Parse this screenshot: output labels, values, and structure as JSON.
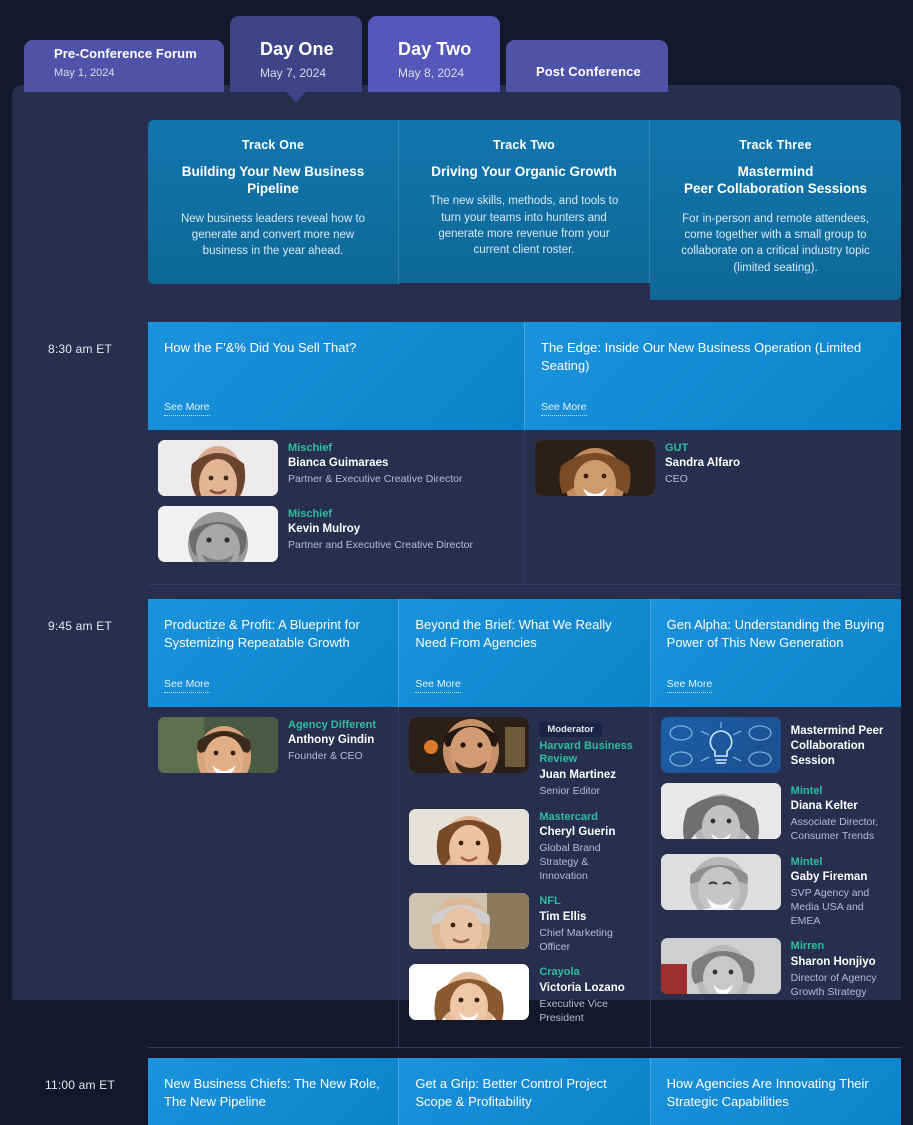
{
  "tabs": [
    {
      "name": "Pre-Conference Forum",
      "label": "Pre-Conference Forum",
      "date": "May 1, 2024",
      "active": false
    },
    {
      "name": "Day One",
      "label": "Day One",
      "date": "May 7, 2024",
      "active": true
    },
    {
      "name": "Day Two",
      "label": "Day Two",
      "date": "May 8, 2024",
      "active": false
    },
    {
      "name": "Post Conference",
      "label": "Post Conference",
      "date": "",
      "active": false
    }
  ],
  "tracks": [
    {
      "num": "Track One",
      "title": "Building Your New Business Pipeline",
      "desc": "New business leaders reveal how to generate and convert more new business in the year ahead."
    },
    {
      "num": "Track Two",
      "title": "Driving Your Organic Growth",
      "desc": "The new skills, methods, and tools to turn your teams into hunters and generate more revenue from your current client roster."
    },
    {
      "num": "Track Three",
      "title": "Mastermind\nPeer Collaboration Sessions",
      "title_line1": "Mastermind",
      "title_line2": "Peer Collaboration Sessions",
      "desc": "For in-person and remote attendees, come together with a small group to collaborate on a critical industry topic (limited seating)."
    }
  ],
  "see_more_label": "See More",
  "rows": [
    {
      "time": "8:30 am ET",
      "sessions": [
        {
          "title": "How the F'&% Did You Sell That?",
          "see_more": "See More"
        },
        {
          "title": "The Edge: Inside Our New Business Operation (Limited Seating)",
          "see_more": "See More"
        }
      ],
      "speaker_groups": [
        [
          {
            "company": "Mischief",
            "name": "Bianca Guimaraes",
            "role": "Partner & Executive Creative Director",
            "badge": ""
          },
          {
            "company": "Mischief",
            "name": "Kevin Mulroy",
            "role": "Partner and Executive Creative Director",
            "badge": ""
          }
        ],
        [
          {
            "company": "GUT",
            "name": "Sandra Alfaro",
            "role": "CEO",
            "badge": ""
          }
        ]
      ]
    },
    {
      "time": "9:45 am ET",
      "sessions": [
        {
          "title": "Productize & Profit: A Blueprint for Systemizing Repeatable Growth",
          "see_more": "See More"
        },
        {
          "title": "Beyond the Brief: What We Really Need From Agencies",
          "see_more": "See More"
        },
        {
          "title": "Gen Alpha: Understanding the Buying Power of This New Generation",
          "see_more": "See More"
        }
      ],
      "speaker_groups": [
        [
          {
            "company": "Agency Different",
            "name": "Anthony Gindin",
            "role": "Founder & CEO",
            "badge": ""
          }
        ],
        [
          {
            "company": "Harvard Business Review",
            "name": "Juan Martinez",
            "role": "Senior Editor",
            "badge": "Moderator"
          },
          {
            "company": "Mastercard",
            "name": "Cheryl Guerin",
            "role": "Global Brand Strategy & Innovation",
            "badge": ""
          },
          {
            "company": "NFL",
            "name": "Tim Ellis",
            "role": "Chief Marketing Officer",
            "badge": ""
          },
          {
            "company": "Crayola",
            "name": "Victoria Lozano",
            "role": "Executive Vice President",
            "badge": ""
          }
        ],
        [
          {
            "mastermind": "Mastermind Peer Collaboration Session"
          },
          {
            "company": "Mintel",
            "name": "Diana Kelter",
            "role": "Associate Director, Consumer Trends",
            "badge": ""
          },
          {
            "company": "Mintel",
            "name": "Gaby Fireman",
            "role": "SVP Agency and Media USA and EMEA",
            "badge": ""
          },
          {
            "company": "Mirren",
            "name": "Sharon Honjiyo",
            "role": "Director of Agency Growth Strategy",
            "badge": ""
          }
        ]
      ]
    },
    {
      "time": "11:00 am ET",
      "sessions": [
        {
          "title": "New Business Chiefs: The New Role, The New Pipeline",
          "see_more": ""
        },
        {
          "title": "Get a Grip: Better Control Project Scope & Profitability",
          "see_more": ""
        },
        {
          "title": "How Agencies Are Innovating Their Strategic Capabilities",
          "see_more": ""
        }
      ],
      "speaker_groups": []
    }
  ],
  "colors": {
    "page_background": "#15172b",
    "panel_background": "#272e4e",
    "tab_active": "#3f4488",
    "tab_inactive": "#4f53a8",
    "tab_highlight": "#5458b8",
    "session_blue": "#1b93dd",
    "track_header_blue": "#1176ae",
    "company_teal": "#2fbfa0",
    "role_gray": "#b6bdd2"
  }
}
